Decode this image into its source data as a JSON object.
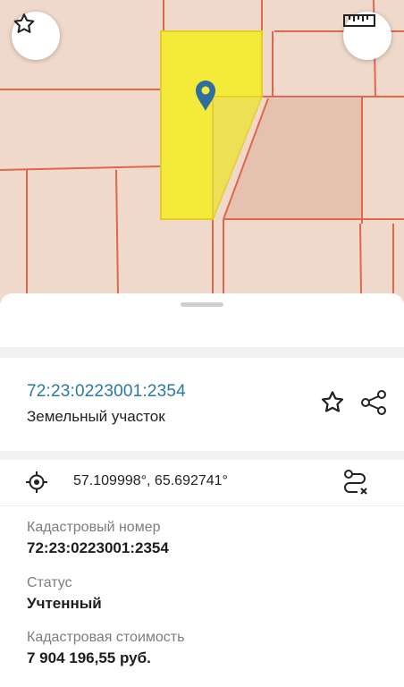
{
  "map": {
    "favorite_icon": "star-outline-icon",
    "ruler_icon": "ruler-icon",
    "marker_icon": "map-pin-icon",
    "colors": {
      "background": "#efd9cb",
      "parcel_border": "#e0674a",
      "selected_parcel": "#f4ea3a",
      "marker": "#2f6f9f"
    }
  },
  "parcel": {
    "cadastral_link": "72:23:0223001:2354",
    "type": "Земельный участок",
    "coordinates": "57.109998°, 65.692741°"
  },
  "fields": [
    {
      "label": "Кадастровый номер",
      "value": "72:23:0223001:2354"
    },
    {
      "label": "Статус",
      "value": "Учтенный"
    },
    {
      "label": "Кадастровая стоимость",
      "value": "7 904 196,55 руб."
    }
  ]
}
